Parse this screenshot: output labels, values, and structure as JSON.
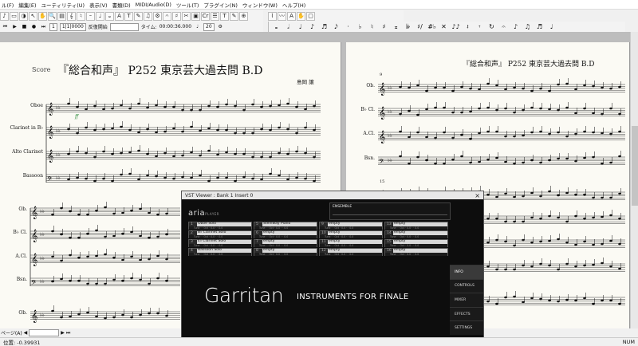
{
  "menu": [
    "ル(F)",
    "編集(E)",
    "ユーティリティ(U)",
    "表示(V)",
    "書類(D)",
    "MIDI/Audio(D)",
    "ツール(T)",
    "プラグイン(N)",
    "ウィンドウ(W)",
    "ヘルプ(H)"
  ],
  "toolbar_icons": [
    "♪",
    "▭",
    "◑",
    "↖",
    "✋",
    "🔍",
    "▤",
    "𝄞",
    "♮",
    "𝄼",
    "♩",
    "𝄪",
    "A",
    "T",
    "✎",
    "♫",
    "⚙",
    "𝄐",
    "♯",
    "✂",
    "▣",
    "Cr",
    "☰",
    "T",
    "✎",
    "⊕",
    "⌇",
    "〰",
    "A",
    "✋",
    "▢"
  ],
  "playback": {
    "counter": "1",
    "measure_field": "1|1|0000",
    "start_label": "反復開始",
    "time_label": "タイム:",
    "time_value": "00:00:36.000",
    "tempo_value": "20"
  },
  "palette_icons": [
    "𝅝",
    "𝅗𝅥",
    "♩",
    "♪",
    "♬",
    "𝅘𝅥𝅯",
    "·",
    "♭",
    "♮",
    "♯",
    "𝄪",
    "𝄫",
    "♯/",
    "#♭",
    "✕",
    "♪♪",
    "𝄽",
    "𝄾",
    "↻",
    "𝄐",
    "♪",
    "♫",
    "♬",
    "♩"
  ],
  "score_left": {
    "score_label": "Score",
    "title": "『総合和声』 P252 東京芸大過去問 B.D",
    "composer": "島岡 譲",
    "system1_labels": [
      "Oboe",
      "Clarinet in B♭",
      "Alto Clarinet",
      "Bassoon"
    ],
    "system2_labels": [
      "Ob.",
      "B♭ Cl.",
      "A.Cl.",
      "Bsn."
    ],
    "system3_labels": [
      "Ob."
    ],
    "dynamic": "ff"
  },
  "score_right": {
    "title": "『総合和声』 P252 東京芸大過去問 B.D",
    "labels": [
      "Ob.",
      "B♭ Cl.",
      "A.Cl.",
      "Bsn."
    ],
    "measure_a": "9",
    "measure_b": "15"
  },
  "vst": {
    "title": "VST Viewer : Bank 1 Insert 0",
    "close": "×",
    "brand": "aria",
    "brand_sub": "PLAYER",
    "ensemble_label": "ENSEMBLE",
    "big_title": "Garritan",
    "subtitle": "INSTRUMENTS FOR FINALE",
    "slot_controls": "Tune · · Oct · 0.0 · · 0.0",
    "slots": [
      {
        "n": "1",
        "name": "Oboe Solo"
      },
      {
        "n": "5",
        "name": "Steinway Piano"
      },
      {
        "n": "9",
        "name": "empty"
      },
      {
        "n": "13",
        "name": "empty"
      },
      {
        "n": "2",
        "name": "B♭ Clarinet Solo"
      },
      {
        "n": "6",
        "name": "empty"
      },
      {
        "n": "10",
        "name": "empty"
      },
      {
        "n": "14",
        "name": "empty"
      },
      {
        "n": "3",
        "name": "E♭ Clarinet Solo"
      },
      {
        "n": "7",
        "name": "empty"
      },
      {
        "n": "11",
        "name": "empty"
      },
      {
        "n": "15",
        "name": "empty"
      },
      {
        "n": "4",
        "name": "Bassoon Solo"
      },
      {
        "n": "8",
        "name": "empty"
      },
      {
        "n": "12",
        "name": "empty"
      },
      {
        "n": "16",
        "name": "empty"
      }
    ],
    "tabs": [
      "INFO",
      "CONTROLS",
      "MIXER",
      "EFFECTS",
      "SETTINGS"
    ]
  },
  "nav": {
    "page_label": "ページ(A)"
  },
  "status": {
    "left": "位置: -0.39931",
    "right": "NUM"
  }
}
